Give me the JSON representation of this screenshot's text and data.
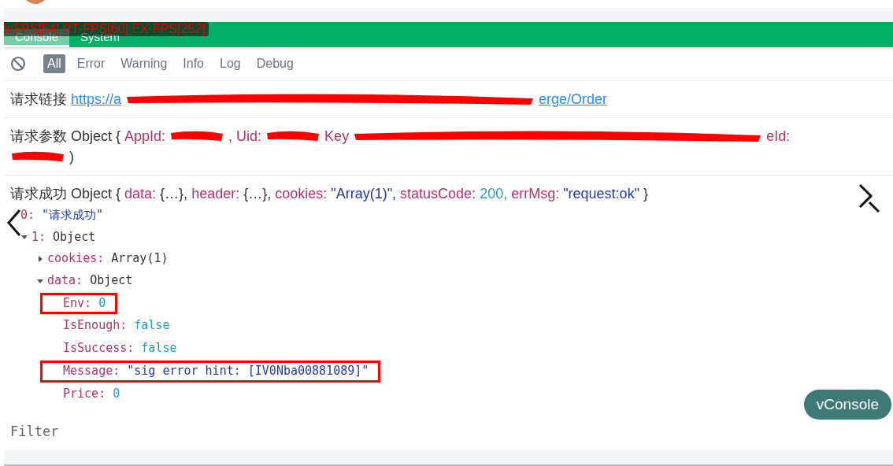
{
  "fps_overlay": "inFPS[54] RT-FPS[60] EX-FPS[252]",
  "tabs": [
    {
      "label": "Console",
      "selected": true
    },
    {
      "label": "System",
      "selected": false
    }
  ],
  "filters": [
    {
      "label": "All",
      "selected": true
    },
    {
      "label": "Error",
      "selected": false
    },
    {
      "label": "Warning",
      "selected": false
    },
    {
      "label": "Info",
      "selected": false
    },
    {
      "label": "Log",
      "selected": false
    },
    {
      "label": "Debug",
      "selected": false
    }
  ],
  "logs": [
    {
      "kind": "link",
      "prefix": "请求链接",
      "parts": [
        {
          "kind": "link",
          "text": "https://a"
        },
        {
          "kind": "redaction"
        },
        {
          "kind": "link",
          "text": "erge/Order"
        }
      ]
    },
    {
      "kind": "params",
      "prefix": "请求参数",
      "parts": [
        {
          "kind": "text",
          "text": "Object {"
        },
        {
          "kind": "key",
          "text": "AppId:"
        },
        {
          "kind": "redaction"
        },
        {
          "kind": "key",
          "text": ", Uid:"
        },
        {
          "kind": "redaction"
        },
        {
          "kind": "key",
          "text": "Key"
        },
        {
          "kind": "long_redaction"
        },
        {
          "kind": "key",
          "text": "eId:"
        }
      ],
      "second_line": ")"
    },
    {
      "kind": "tree",
      "prefix": "请求成功",
      "parts": [
        {
          "kind": "text",
          "text": "Object {"
        },
        {
          "kind": "key",
          "text": "data:"
        },
        {
          "kind": "text",
          "text": "{…},"
        },
        {
          "kind": "key",
          "text": "header:"
        },
        {
          "kind": "text",
          "text": "{…},"
        },
        {
          "kind": "key",
          "text": "cookies:"
        },
        {
          "kind": "string",
          "text": "\"Array(1)\","
        },
        {
          "kind": "key",
          "text": "statusCode:"
        },
        {
          "kind": "number",
          "text": "200,"
        },
        {
          "kind": "key",
          "text": "errMsg:"
        },
        {
          "kind": "string",
          "text": "\"request:ok\""
        },
        {
          "kind": "text",
          "text": "}"
        }
      ],
      "children": [
        {
          "key": "0:",
          "value": "\"请求成功\"",
          "kind": "string"
        },
        {
          "key": "1:",
          "value": "Object",
          "kind": "object",
          "expanded": true,
          "children": [
            {
              "key": "cookies:",
              "value": "Array(1)",
              "kind": "object",
              "expanded": false
            },
            {
              "key": "data:",
              "value": "Object",
              "kind": "object",
              "expanded": true,
              "children": [
                {
                  "key": "Env:",
                  "value": "0",
                  "kind": "number",
                  "highlighted": true
                },
                {
                  "key": "IsEnough:",
                  "value": "false",
                  "kind": "number",
                  "highlighted": false
                },
                {
                  "key": "IsSuccess:",
                  "value": "false",
                  "kind": "number",
                  "highlighted": false
                },
                {
                  "key": "Message:",
                  "value": "\"sig error hint: [IV0Nba00881089]\"",
                  "kind": "string",
                  "highlighted": true
                },
                {
                  "key": "Price:",
                  "value": "0",
                  "kind": "number",
                  "highlighted": false
                }
              ]
            }
          ]
        }
      ]
    }
  ],
  "filter_placeholder": "Filter",
  "float_button": "vConsole"
}
